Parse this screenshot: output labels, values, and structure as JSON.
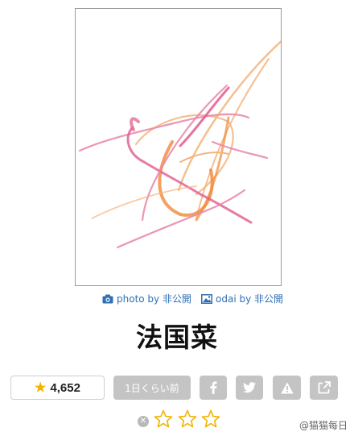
{
  "image": {
    "description_icon": "calligraphy-image"
  },
  "credits": {
    "photo_icon": "camera-icon",
    "photo_text": "photo by 非公開",
    "odai_icon": "image-icon",
    "odai_text": "odai by 非公開",
    "link_color": "#2f6fb5"
  },
  "title": "法国菜",
  "actions": {
    "score": "4,652",
    "score_icon": "star-icon",
    "time_label": "1日くらい前",
    "facebook_icon": "facebook-icon",
    "twitter_icon": "twitter-icon",
    "report_icon": "warning-icon",
    "share_icon": "external-link-icon",
    "button_color": "#c4c4c4",
    "star_color": "#f2b300"
  },
  "rating": {
    "clear_icon": "clear-icon",
    "stars": 3,
    "filled": 0
  },
  "watermark": "@猫猫每日"
}
